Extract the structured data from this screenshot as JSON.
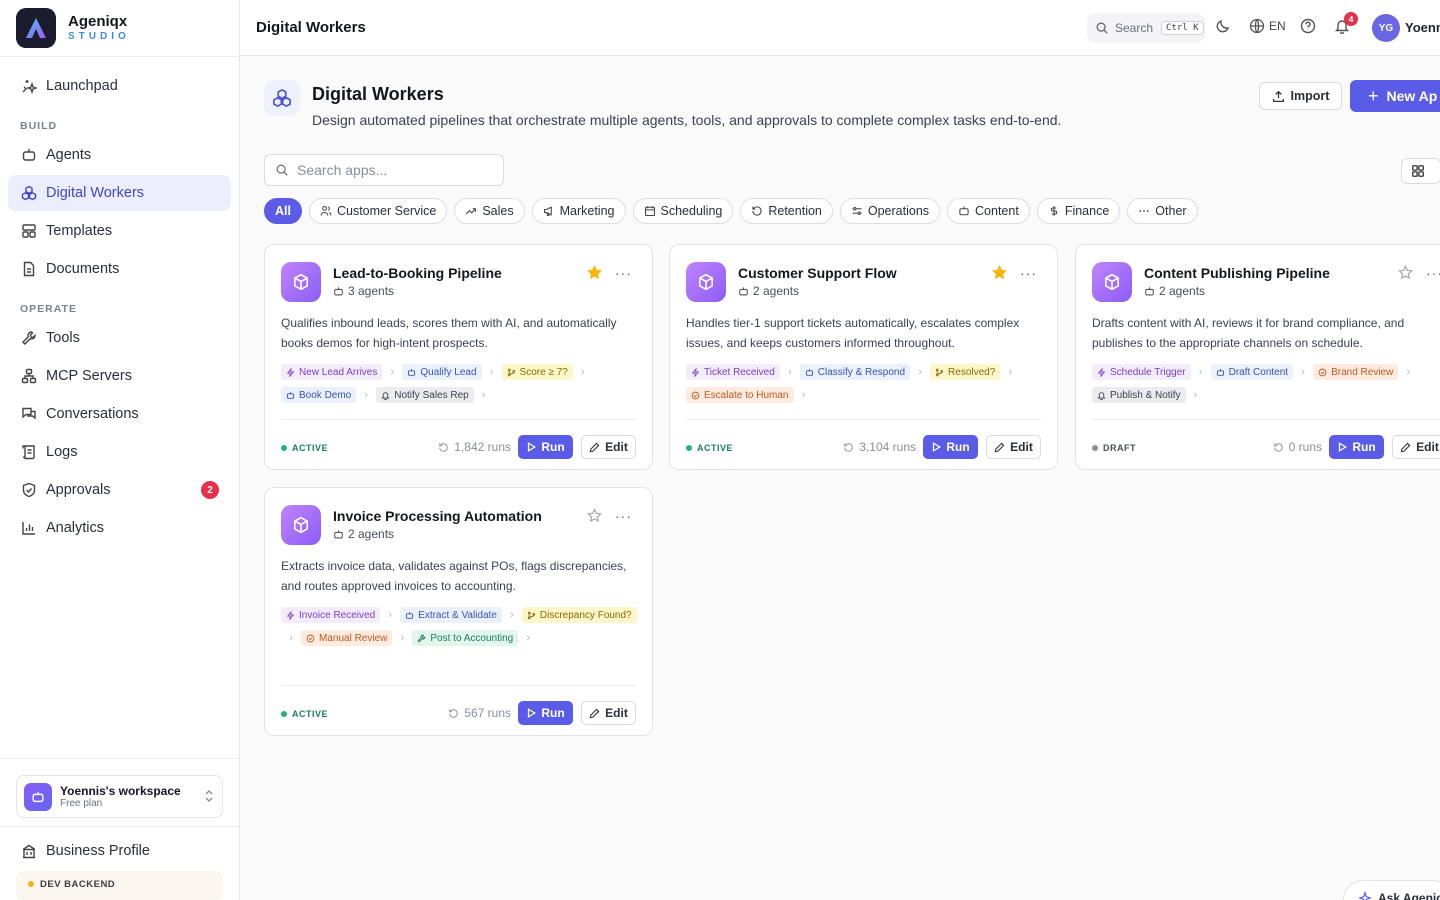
{
  "brand": {
    "name": "Ageniqx",
    "sub": "STUDIO"
  },
  "sidebar": {
    "launchpad": "Launchpad",
    "build_label": "BUILD",
    "build": [
      {
        "label": "Agents"
      },
      {
        "label": "Digital Workers"
      },
      {
        "label": "Templates"
      },
      {
        "label": "Documents"
      }
    ],
    "operate_label": "OPERATE",
    "operate": [
      {
        "label": "Tools"
      },
      {
        "label": "MCP Servers"
      },
      {
        "label": "Conversations"
      },
      {
        "label": "Logs"
      },
      {
        "label": "Approvals",
        "badge": "2"
      },
      {
        "label": "Analytics"
      }
    ],
    "workspace": {
      "name": "Yoennis's workspace",
      "plan": "Free plan"
    },
    "business_profile": "Business Profile",
    "dev_backend": "DEV BACKEND"
  },
  "topbar": {
    "title": "Digital Workers",
    "search": "Search",
    "shortcut": "Ctrl K",
    "lang": "EN",
    "notif_count": "4",
    "avatar": "YG",
    "user": "Yoenn"
  },
  "page": {
    "title": "Digital Workers",
    "description": "Design automated pipelines that orchestrate multiple agents, tools, and approvals to complete complex tasks end-to-end.",
    "import_label": "Import",
    "new_label": "New Ap",
    "search_placeholder": "Search apps..."
  },
  "filters": [
    {
      "label": "All",
      "icon": "none"
    },
    {
      "label": "Customer Service",
      "icon": "users-icon"
    },
    {
      "label": "Sales",
      "icon": "trend-icon"
    },
    {
      "label": "Marketing",
      "icon": "megaphone-icon"
    },
    {
      "label": "Scheduling",
      "icon": "calendar-icon"
    },
    {
      "label": "Retention",
      "icon": "refresh-icon"
    },
    {
      "label": "Operations",
      "icon": "sliders-icon"
    },
    {
      "label": "Content",
      "icon": "bot-icon"
    },
    {
      "label": "Finance",
      "icon": "dollar-icon"
    },
    {
      "label": "Other",
      "icon": "dots-icon"
    }
  ],
  "cards": [
    {
      "title": "Lead-to-Booking Pipeline",
      "agents": "3 agents",
      "starred": true,
      "description": "Qualifies inbound leads, scores them with AI, and automatically books demos for high-intent prospects.",
      "steps": [
        {
          "label": "New Lead Arrives",
          "type": "trigger"
        },
        {
          "label": "Qualify Lead",
          "type": "agent"
        },
        {
          "label": "Score ≥ 7?",
          "type": "cond"
        },
        {
          "label": "Book Demo",
          "type": "agent"
        },
        {
          "label": "Notify Sales Rep",
          "type": "notify"
        }
      ],
      "status": "ACTIVE",
      "runs": "1,842 runs",
      "run_label": "Run",
      "edit_label": "Edit"
    },
    {
      "title": "Customer Support Flow",
      "agents": "2 agents",
      "starred": true,
      "description": "Handles tier-1 support tickets automatically, escalates complex issues, and keeps customers informed throughout.",
      "steps": [
        {
          "label": "Ticket Received",
          "type": "trigger"
        },
        {
          "label": "Classify & Respond",
          "type": "agent"
        },
        {
          "label": "Resolved?",
          "type": "cond"
        },
        {
          "label": "Escalate to Human",
          "type": "review"
        }
      ],
      "status": "ACTIVE",
      "runs": "3,104 runs",
      "run_label": "Run",
      "edit_label": "Edit"
    },
    {
      "title": "Content Publishing Pipeline",
      "agents": "2 agents",
      "starred": false,
      "description": "Drafts content with AI, reviews it for brand compliance, and publishes to the appropriate channels on schedule.",
      "steps": [
        {
          "label": "Schedule Trigger",
          "type": "trigger"
        },
        {
          "label": "Draft Content",
          "type": "agent"
        },
        {
          "label": "Brand Review",
          "type": "review"
        },
        {
          "label": "Publish & Notify",
          "type": "notify"
        }
      ],
      "status": "DRAFT",
      "runs": "0 runs",
      "run_label": "Run",
      "edit_label": "Edit"
    },
    {
      "title": "Invoice Processing Automation",
      "agents": "2 agents",
      "starred": false,
      "description": "Extracts invoice data, validates against POs, flags discrepancies, and routes approved invoices to accounting.",
      "steps": [
        {
          "label": "Invoice Received",
          "type": "trigger"
        },
        {
          "label": "Extract & Validate",
          "type": "agent"
        },
        {
          "label": "Discrepancy Found?",
          "type": "cond"
        },
        {
          "label": "Manual Review",
          "type": "review"
        },
        {
          "label": "Post to Accounting",
          "type": "tool"
        }
      ],
      "status": "ACTIVE",
      "runs": "567 runs",
      "run_label": "Run",
      "edit_label": "Edit"
    }
  ],
  "ask_label": "Ask Agenic",
  "colors": {
    "accent": "#5a5ce8",
    "active": "#1fb57a",
    "draft": "#8a8e9b",
    "star": "#f5b50a",
    "danger": "#e4304b"
  }
}
